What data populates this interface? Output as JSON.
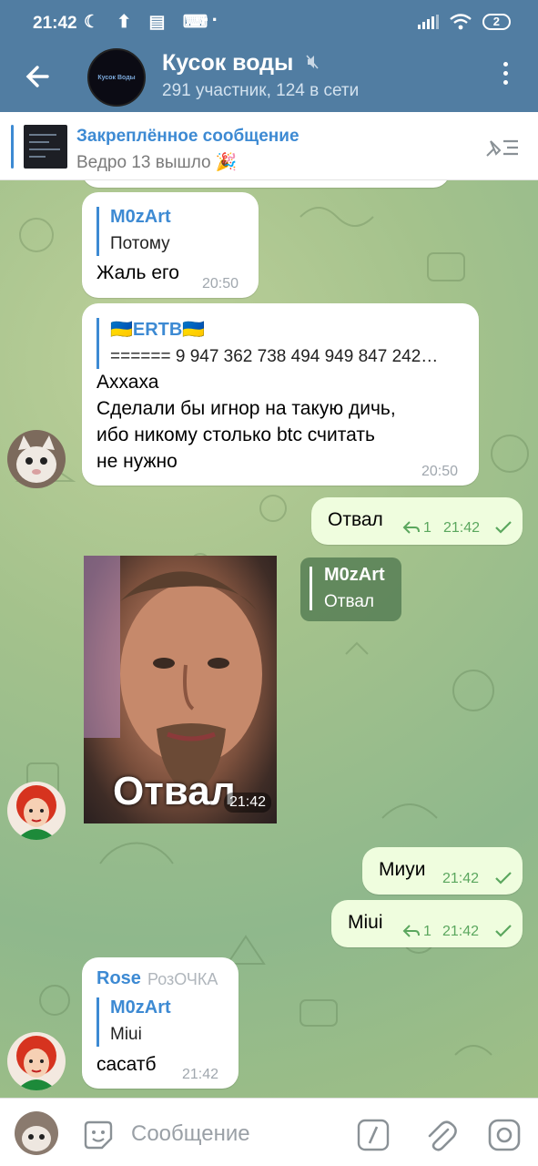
{
  "status_bar": {
    "time": "21:42",
    "left_icons": "☾ ⬆ ▤ ⌨",
    "dots": "···",
    "battery": "2"
  },
  "header": {
    "back_icon": "arrow-left-icon",
    "avatar_text": "Кусок Воды",
    "title": "Кусок воды",
    "subtitle": "291 участник, 124 в сети",
    "muted_icon": "mute-icon",
    "menu_icon": "more-vertical-icon"
  },
  "pinned": {
    "title": "Закреплённое сообщение",
    "text": "Ведро 13 вышло 🎉",
    "close_icon": "pin-list-icon"
  },
  "messages": [
    {
      "reply_name": "M0zArt",
      "reply_text": "Потому",
      "text": "Жаль его",
      "time": "20:50"
    },
    {
      "reply_name": "🇺🇦ERTB🇺🇦",
      "reply_text": "====== 9 947 362 738 494 949 847 242…",
      "lines": [
        "Аххаха",
        "Сделали бы игнор на такую дичь,",
        "ибо никому столько btc считать",
        "не нужно"
      ],
      "time": "20:50"
    },
    {
      "text": "Отвал",
      "forwards": "1",
      "time": "21:42"
    },
    {
      "photo_caption": "Отвал",
      "time": "21:42",
      "reply_name": "M0zArt",
      "reply_text": "Отвал"
    },
    {
      "text": "Миуи",
      "time": "21:42"
    },
    {
      "text": "Miui",
      "forwards": "1",
      "time": "21:42"
    },
    {
      "sender": "Rose",
      "sender_title": "РозОЧКА",
      "reply_name": "M0zArt",
      "reply_text": "Miui",
      "text": "сасатб",
      "time": "21:42"
    }
  ],
  "input": {
    "placeholder": "Сообщение"
  },
  "colors": {
    "header": "#517da2",
    "accent": "#3d8ad3",
    "outgoing": "#effdde",
    "check": "#5ba75e"
  }
}
